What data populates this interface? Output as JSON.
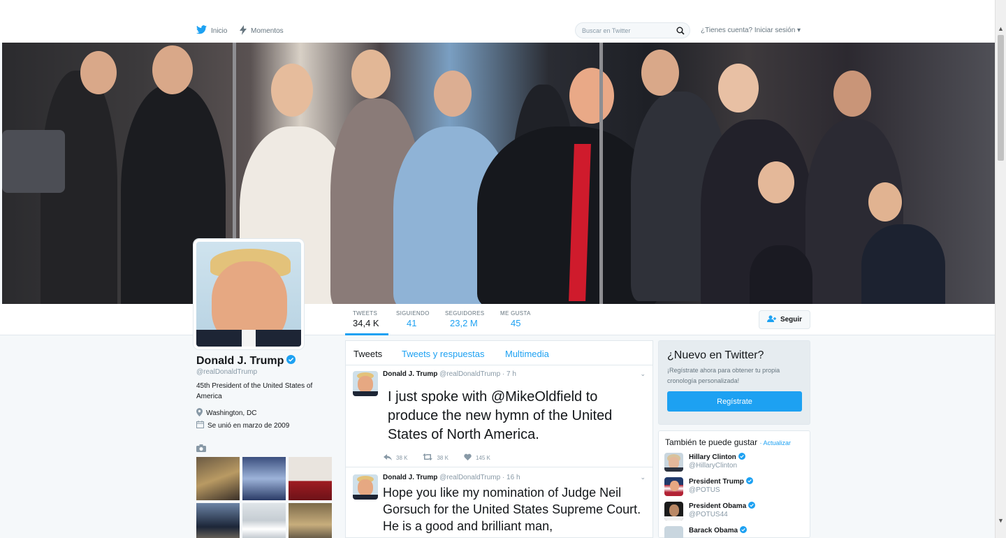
{
  "nav": {
    "home_label": "Inicio",
    "moments_label": "Momentos",
    "search_placeholder": "Buscar en Twitter",
    "login_label": "¿Tienes cuenta? Iniciar sesión"
  },
  "profile": {
    "name": "Donald J. Trump",
    "handle": "@realDonaldTrump",
    "bio": "45th President of the United States of America",
    "location": "Washington, DC",
    "joined": "Se unió en marzo de 2009"
  },
  "stats": [
    {
      "label": "TWEETS",
      "value": "34,4 K"
    },
    {
      "label": "SIGUIENDO",
      "value": "41"
    },
    {
      "label": "SEGUIDORES",
      "value": "23,2 M"
    },
    {
      "label": "ME GUSTA",
      "value": "45"
    }
  ],
  "follow_button": "Seguir",
  "timeline": {
    "tabs": [
      "Tweets",
      "Tweets y respuestas",
      "Multimedia"
    ],
    "tweets": [
      {
        "name": "Donald J. Trump",
        "handle": "@realDonaldTrump",
        "time": "· 7 h",
        "text": "I just spoke with @MikeOldfield to produce the new hymn of the United States of North America.",
        "replies": "38 K",
        "retweets": "38 K",
        "likes": "145 K"
      },
      {
        "name": "Donald J. Trump",
        "handle": "@realDonaldTrump",
        "time": "· 16 h",
        "text": "Hope you like my nomination of Judge Neil Gorsuch for the United States Supreme Court. He is a good and brilliant man,"
      }
    ]
  },
  "signup": {
    "title": "¿Nuevo en Twitter?",
    "subtitle": "¡Regístrate ahora para obtener tu propia cronología personalizada!",
    "button": "Regístrate"
  },
  "suggestions": {
    "title": "También te puede gustar",
    "refresh": "· Actualizar",
    "items": [
      {
        "name": "Hillary Clinton",
        "handle": "@HillaryClinton"
      },
      {
        "name": "President Trump",
        "handle": "@POTUS"
      },
      {
        "name": "President Obama",
        "handle": "@POTUS44"
      },
      {
        "name": "Barack Obama",
        "handle": ""
      }
    ]
  },
  "colors": {
    "accent": "#1da1f2",
    "text": "#14171a",
    "muted": "#8899a6",
    "background": "#f5f8fa"
  }
}
